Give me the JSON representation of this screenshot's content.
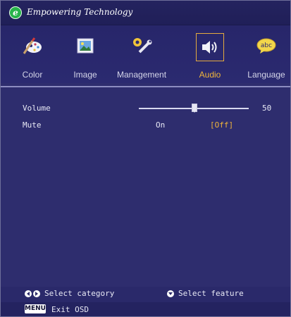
{
  "header": {
    "logo_letter": "e",
    "brand": "Empowering Technology"
  },
  "tabs": [
    {
      "label": "Color",
      "icon": "color-palette-icon",
      "active": false
    },
    {
      "label": "Image",
      "icon": "image-picture-icon",
      "active": false
    },
    {
      "label": "Management",
      "icon": "management-tools-icon",
      "active": false
    },
    {
      "label": "Audio",
      "icon": "audio-speaker-icon",
      "active": true
    },
    {
      "label": "Language",
      "icon": "language-bubble-icon",
      "active": false
    }
  ],
  "settings": {
    "volume": {
      "label": "Volume",
      "value": "50",
      "level": 0.5
    },
    "mute": {
      "label": "Mute",
      "option_on": "On",
      "option_off": "[Off]",
      "selected": "Off"
    }
  },
  "footer": {
    "select_category": "Select category",
    "select_feature": "Select feature",
    "menu_key": "MENU",
    "exit_osd": "Exit OSD"
  },
  "colors": {
    "accent": "#f1b53a",
    "background": "#2e2d6e",
    "header": "#24235f"
  }
}
